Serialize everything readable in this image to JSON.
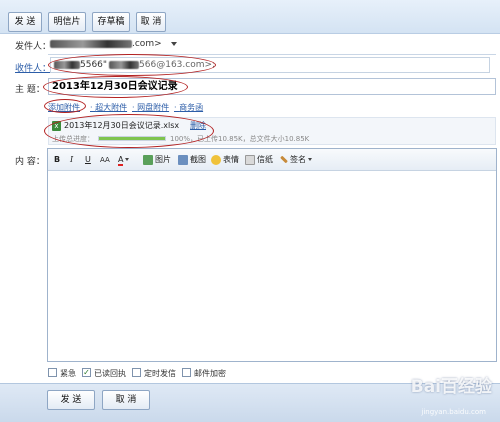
{
  "toolbar_top": {
    "send": "发 送",
    "postcard": "明信片",
    "save_draft": "存草稿",
    "cancel": "取 消"
  },
  "from": {
    "label": "发件人：",
    "value": ".com>"
  },
  "to": {
    "label": "收件人：",
    "value_a": "5566\"",
    "value_b": "566@163.com>;"
  },
  "subject": {
    "label": "主  题：",
    "value": "2013年12月30日会议记录"
  },
  "attach_links": {
    "add": "添加附件",
    "super": "超大附件",
    "netdisk": "网盘附件",
    "business": "商务函"
  },
  "attachment": {
    "filename": "2013年12月30日会议记录.xlsx",
    "delete": "删除",
    "progress_label": "上传总进度：",
    "progress_percent": 100,
    "progress_text": "100%，已上传10.85K，总文件大小10.85K"
  },
  "content": {
    "label": "内  容："
  },
  "editor_toolbar": {
    "bold": "B",
    "italic": "I",
    "underline": "U",
    "font_size": "AA",
    "color": "A",
    "image": "图片",
    "screenshot": "截图",
    "emoji": "表情",
    "letter": "信纸",
    "signature": "签名"
  },
  "options": {
    "urgent": "紧急",
    "read_receipt": "已读回执",
    "scheduled": "定时发信",
    "encrypt": "邮件加密"
  },
  "options_state": {
    "urgent": false,
    "read_receipt": true,
    "scheduled": false,
    "encrypt": false
  },
  "toolbar_bottom": {
    "send": "发 送",
    "cancel": "取 消"
  },
  "watermark": {
    "brand": "Bai百经验",
    "url": "jingyan.baidu.com"
  }
}
